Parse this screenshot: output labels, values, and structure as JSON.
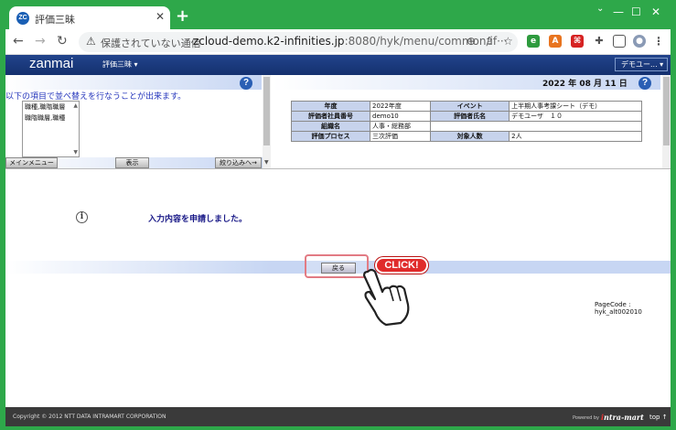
{
  "browser": {
    "tab_title": "評価三昧",
    "tab_favicon_text": "ZC",
    "tab_close": "✕",
    "new_tab": "+",
    "win_minimize": "—",
    "win_maximize": "☐",
    "win_close": "✕",
    "insecure_label": "保護されていない通信",
    "url_host": "zcloud-demo.k2-infinities.jp",
    "url_rest": ":8080/hyk/menu/common/if···"
  },
  "app": {
    "logo": "zanmai",
    "menu_label": "評価三昧 ▾",
    "user_label": "デモユー...  ▾"
  },
  "left_panel": {
    "instruction": "以下の項目で並べ替えを行なうことが出来ます。",
    "sort_items": [
      "職種,職階職層",
      "職階職層,職種"
    ],
    "main_menu_button": "メインメニュー",
    "display_button": "表示",
    "filter_button": "絞り込みへ→"
  },
  "right_panel": {
    "date": "2022 年 08 月 11 日",
    "table": [
      [
        "年度",
        "2022年度",
        "イベント",
        "上半期人事考課シート（デモ）"
      ],
      [
        "評価者社員番号",
        "demo10",
        "評価者氏名",
        "デモユーザ　１０"
      ],
      [
        "組織名",
        "人事・総務部",
        "",
        ""
      ],
      [
        "評価プロセス",
        "三次評価",
        "対象人数",
        "2人"
      ]
    ]
  },
  "message": {
    "text": "入力内容を申請しました。",
    "info_icon": "i"
  },
  "back_button": "戻る",
  "click_badge": "CLICK!",
  "page_code": "PageCode : hyk_alt002010",
  "footer": {
    "copyright": "Copyright © 2012 NTT DATA INTRAMART CORPORATION",
    "powered_by": "Powered by",
    "brand": "ntra-mart",
    "brand_i": "i",
    "top_link": "top ↑"
  },
  "colors": {
    "outer_bg": "#2ea84a",
    "header": "#1c3a7e",
    "table_header": "#c7d3ec",
    "click_red": "#e02b2b"
  }
}
